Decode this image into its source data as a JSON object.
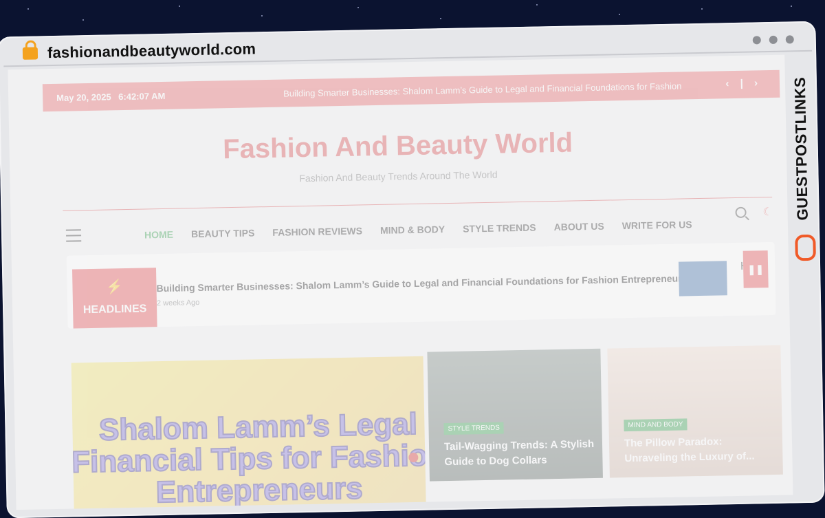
{
  "browser": {
    "url": "fashionandbeautyworld.com",
    "side_brand": "GUESTPOSTLINKS"
  },
  "topbar": {
    "date": "May 20, 2025",
    "time": "6:42:07 AM",
    "ticker": "Building Smarter Businesses: Shalom Lamm’s Guide to Legal and Financial Foundations for Fashion",
    "nav": "‹ | ›"
  },
  "site": {
    "title": "Fashion And Beauty World",
    "tagline": "Fashion And Beauty Trends Around The World"
  },
  "menu": {
    "items": [
      "HOME",
      "BEAUTY TIPS",
      "FASHION REVIEWS",
      "MIND & BODY",
      "STYLE TRENDS",
      "ABOUT US",
      "WRITE FOR US"
    ]
  },
  "headlines": {
    "badge": "HEADLINES",
    "title": "Building Smarter Businesses: Shalom Lamm’s Guide to Legal and Financial Foundations for Fashion Entrepreneurs",
    "meta": "2 weeks Ago",
    "next_peek": "H"
  },
  "hero": {
    "poster_text": "Shalom Lamm’s Legal Financial Tips for Fashion Entrepreneurs"
  },
  "cards": [
    {
      "tag": "STYLE TRENDS",
      "title": "Tail-Wagging Trends: A Stylish Guide to Dog Collars"
    },
    {
      "tag": "MIND AND BODY",
      "title": "The Pillow Paradox: Unraveling the Luxury of..."
    }
  ],
  "colors": {
    "accent": "#e86466",
    "green": "#2e9c4a"
  }
}
